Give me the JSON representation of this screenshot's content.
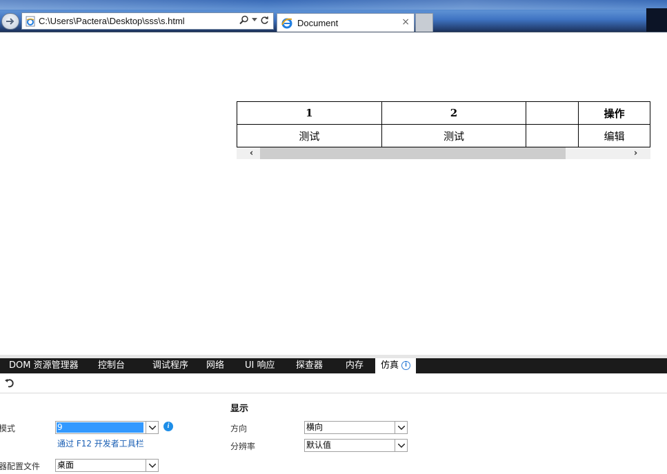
{
  "browser": {
    "address_url": "C:\\Users\\Pactera\\Desktop\\sss\\s.html",
    "tab_title": "Document",
    "tab_close": "×"
  },
  "page_table": {
    "headers": [
      "1",
      "2",
      "",
      "操作"
    ],
    "rows": [
      [
        "测试",
        "测试",
        "",
        "编辑"
      ]
    ]
  },
  "devtools": {
    "tabs": [
      {
        "label": "DOM 资源管理器"
      },
      {
        "label": "控制台"
      },
      {
        "label": "调试程序"
      },
      {
        "label": "网络"
      },
      {
        "label": "UI 响应"
      },
      {
        "label": "探查器"
      },
      {
        "label": "内存"
      },
      {
        "label": "仿真",
        "active": true
      }
    ],
    "display_heading": "显示",
    "mode_label": "模式",
    "mode_value": "9",
    "mode_link": "通过 F12 开发者工具栏",
    "profile_label": "器配置文件",
    "profile_value": "桌面",
    "orientation_label": "方向",
    "orientation_value": "横向",
    "resolution_label": "分辨率",
    "resolution_value": "默认值"
  },
  "colors": {
    "selection": "#3399ff",
    "info_blue": "#1e8ee8",
    "link": "#1a5fb4",
    "devtools_tabbar": "#1b1b1b"
  }
}
